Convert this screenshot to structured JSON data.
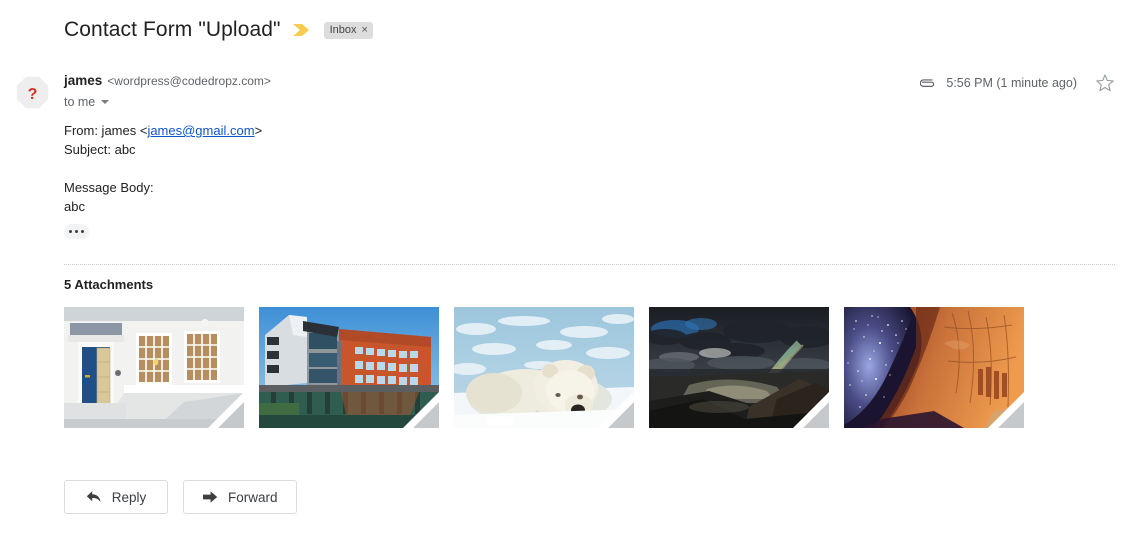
{
  "subject": {
    "title": "Contact Form \"Upload\"",
    "important_marker_icon": "important-chevron-icon",
    "important_marker_color": "#f7cb4d",
    "label": "Inbox",
    "label_remove": "×"
  },
  "sender": {
    "avatar_icon": "unknown-sender-avatar-icon",
    "avatar_glyph": "?",
    "avatar_bg": "#eeeeee",
    "avatar_glyph_color": "#d93025",
    "name": "james",
    "email": "<wordpress@codedropz.com>",
    "recipient": "to me",
    "details_icon": "chevron-down-icon"
  },
  "meta": {
    "attachment_icon": "paperclip-icon",
    "time": "5:56 PM (1 minute ago)",
    "star_icon": "star-outline-icon"
  },
  "body": {
    "from_prefix": "From: james <",
    "from_link": "james@gmail.com",
    "from_suffix": ">",
    "subject_line": "Subject: abc",
    "message_body_label": "Message Body:",
    "message_body_text": "abc",
    "expand_icon": "ellipsis-icon",
    "link_color": "#1155cc"
  },
  "attachments": {
    "heading": "5 Attachments",
    "items": [
      {
        "name": "white-building-blue-door-photo",
        "alt": "White townhouse facade with blue front door and sash windows"
      },
      {
        "name": "waterfront-office-building-photo",
        "alt": "Modern orange and glass office building beside water"
      },
      {
        "name": "polar-bear-snow-photo",
        "alt": "Polar bear resting on snow in front of pale blue ice"
      },
      {
        "name": "storm-rainbow-landscape-photo",
        "alt": "Dark stormy mountain landscape with a rainbow"
      },
      {
        "name": "milky-way-canyon-photo",
        "alt": "Starry night sky framed by a red sandstone canyon arch"
      }
    ]
  },
  "actions": {
    "reply_label": "Reply",
    "reply_icon": "reply-arrow-icon",
    "forward_label": "Forward",
    "forward_icon": "forward-arrow-icon"
  }
}
